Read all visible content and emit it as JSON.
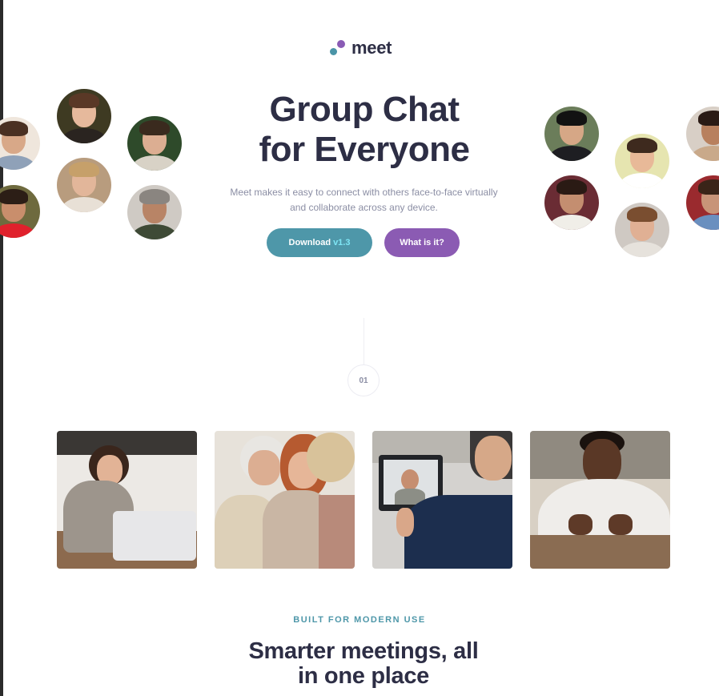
{
  "brand": {
    "name": "meet",
    "teal": "#4a94a7",
    "purple": "#8a5bb5",
    "dark": "#2d2e45"
  },
  "hero": {
    "title_line1": "Group Chat",
    "title_line2": "for Everyone",
    "subtitle_line1": "Meet makes it easy to connect with others face-to-face virtually",
    "subtitle_line2": "and collaborate across any device.",
    "download_label": "Download",
    "download_version": "v1.3",
    "what_label": "What is it?"
  },
  "avatars_left": [
    "person-avatar",
    "person-avatar",
    "person-avatar",
    "person-avatar",
    "person-avatar",
    "person-avatar",
    "person-avatar"
  ],
  "avatars_right": [
    "person-avatar",
    "person-avatar",
    "person-avatar",
    "person-avatar",
    "person-avatar",
    "person-avatar"
  ],
  "step": {
    "number": "01"
  },
  "photos": [
    "woman-with-laptop-photo",
    "women-with-phone-photo",
    "man-on-video-call-photo",
    "man-with-phone-photo"
  ],
  "section": {
    "eyebrow": "BUILT FOR MODERN USE",
    "heading_line1": "Smarter meetings, all",
    "heading_line2": "in one place"
  }
}
